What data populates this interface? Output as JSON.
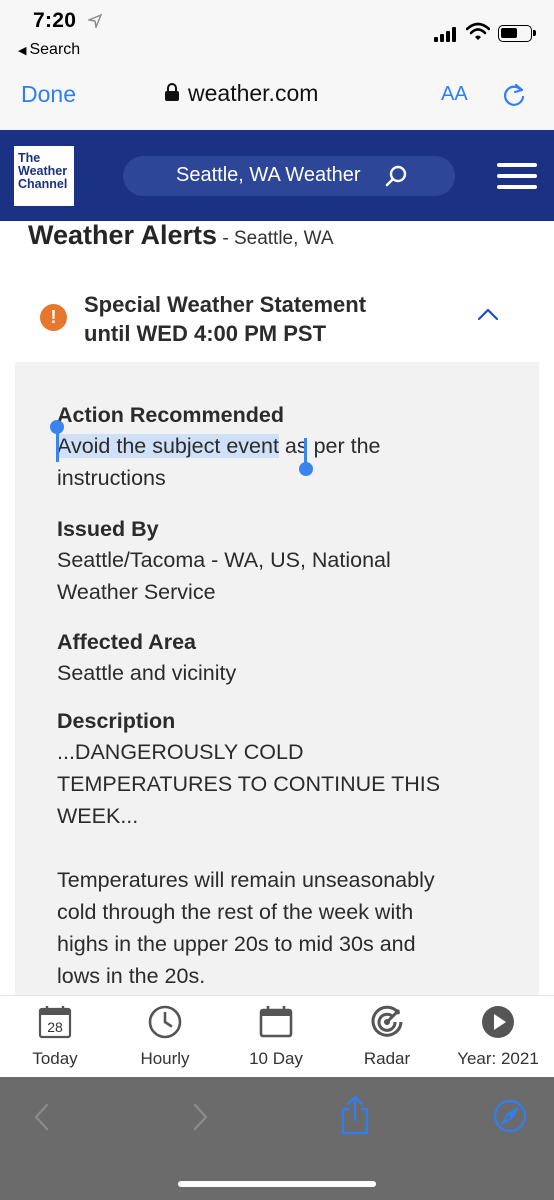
{
  "status_bar": {
    "time": "7:20",
    "back_label": "Search"
  },
  "browser": {
    "done_label": "Done",
    "url": "weather.com",
    "text_size_label": "AA"
  },
  "site_header": {
    "logo_lines": [
      "The",
      "Weather",
      "Channel"
    ],
    "search_text": "Seattle, WA Weather"
  },
  "page": {
    "title": "Weather Alerts",
    "subtitle": " - Seattle, WA"
  },
  "alert": {
    "title_line1": "Special Weather Statement",
    "title_line2": "until WED 4:00 PM PST",
    "icon_symbol": "!",
    "icon_color": "#e8772e"
  },
  "details": {
    "action_label": "Action Recommended",
    "action_selected": "Avoid the subject event",
    "action_rest1": " as per the",
    "action_rest2": "instructions",
    "issued_label": "Issued By",
    "issued_line1": "Seattle/Tacoma - WA, US, National",
    "issued_line2": "Weather Service",
    "area_label": "Affected Area",
    "area_value": "Seattle and vicinity",
    "description_label": "Description",
    "description_lines": [
      "...DANGEROUSLY COLD",
      "TEMPERATURES TO CONTINUE THIS",
      "WEEK...",
      "",
      "Temperatures will remain unseasonably",
      "cold through the rest of the week with",
      "highs in the upper 20s to mid 30s and",
      "lows in the 20s."
    ]
  },
  "tabs": [
    {
      "label": "Today",
      "icon": "calendar-day-icon",
      "day": "28"
    },
    {
      "label": "Hourly",
      "icon": "clock-icon"
    },
    {
      "label": "10 Day",
      "icon": "calendar-icon"
    },
    {
      "label": "Radar",
      "icon": "radar-icon"
    },
    {
      "label": "Year: 2021",
      "icon": "play-icon"
    }
  ],
  "colors": {
    "header_blue": "#1b3183",
    "ios_blue": "#2f7ef6",
    "selection_blue": "#3a84f0"
  }
}
